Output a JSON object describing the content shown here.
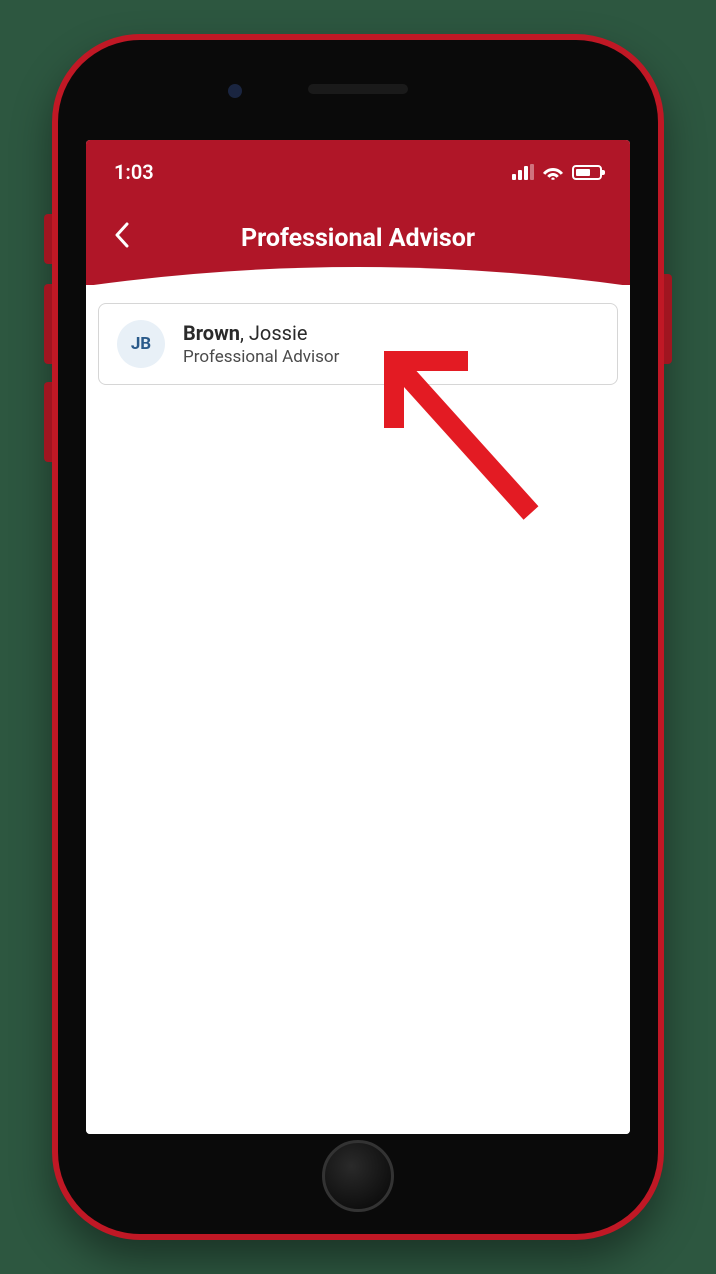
{
  "status_bar": {
    "time": "1:03"
  },
  "nav": {
    "title": "Professional Advisor"
  },
  "advisor_card": {
    "initials": "JB",
    "last_name": "Brown",
    "name_rest": ", Jossie",
    "subtitle": "Professional Advisor"
  },
  "colors": {
    "header_red": "#b01628",
    "arrow_red": "#e31b23",
    "avatar_bg": "#e8f0f7",
    "avatar_text": "#2a5a8a"
  }
}
